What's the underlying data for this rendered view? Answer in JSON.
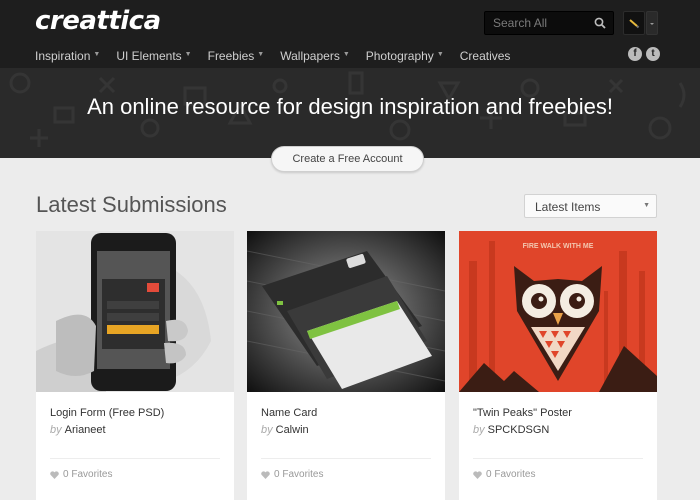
{
  "brand": {
    "logo": "creattica"
  },
  "search": {
    "placeholder": "Search All"
  },
  "nav": [
    {
      "label": "Inspiration",
      "dropdown": true
    },
    {
      "label": "UI Elements",
      "dropdown": true
    },
    {
      "label": "Freebies",
      "dropdown": true
    },
    {
      "label": "Wallpapers",
      "dropdown": true
    },
    {
      "label": "Photography",
      "dropdown": true
    },
    {
      "label": "Creatives",
      "dropdown": false
    }
  ],
  "social": {
    "facebook": "f",
    "twitter": "t"
  },
  "hero": {
    "headline": "An online resource for design inspiration and freebies!",
    "cta_label": "Create a Free Account"
  },
  "submissions": {
    "heading": "Latest Submissions",
    "sort_selected": "Latest Items",
    "by_label": "by",
    "items": [
      {
        "title": "Login Form (Free PSD)",
        "author": "Arianeet",
        "favorites": "0 Favorites",
        "image": "phone-login-form-photo"
      },
      {
        "title": "Name Card",
        "author": "Calwin",
        "favorites": "0 Favorites",
        "image": "business-cards-photo"
      },
      {
        "title": "\"Twin Peaks\" Poster",
        "author": "SPCKDSGN",
        "favorites": "0 Favorites",
        "image": "owl-poster-illustration",
        "image_text": "FIRE WALK WITH ME"
      }
    ]
  },
  "colors": {
    "header_bg": "#1e1e1e",
    "page_bg": "#ececec",
    "poster_red": "#e0452a",
    "heart": "#bbbbbb"
  }
}
